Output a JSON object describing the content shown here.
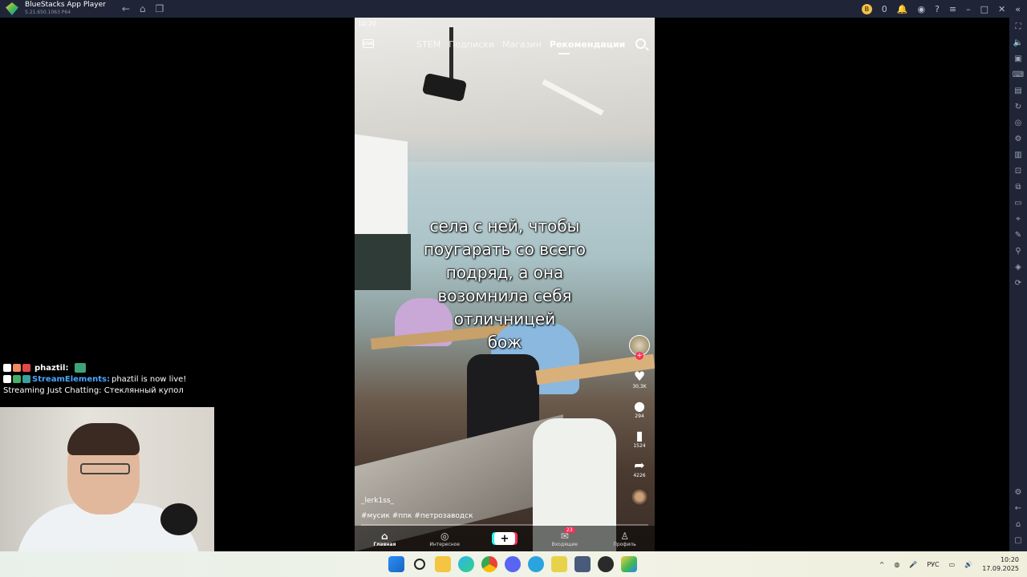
{
  "window": {
    "title": "BlueStacks App Player",
    "version": "5.21.650.1063 P64",
    "coins": "0"
  },
  "phone": {
    "status_time": "10:20",
    "live_label": "LIVE",
    "tabs": [
      {
        "label": "STEM"
      },
      {
        "label": "Подписки"
      },
      {
        "label": "Магазин"
      },
      {
        "label": "Рекомендации"
      }
    ],
    "caption_lines": [
      "села с ней, чтобы",
      "поугарать со всего",
      "подряд, а она",
      "возомнила себя",
      "отличницей",
      "бож"
    ],
    "actions": {
      "likes": "30,3K",
      "comments": "294",
      "saves": "1524",
      "shares": "4226"
    },
    "username": "_lerk1ss_",
    "hashtags": "#мусик #ппк #петрозаводск",
    "bottom_nav": [
      {
        "label": "Главная"
      },
      {
        "label": "Интересное"
      },
      {
        "label": "+"
      },
      {
        "label": "Входящие"
      },
      {
        "label": "Профиль"
      }
    ],
    "inbox_badge": "23"
  },
  "chat": {
    "messages": [
      {
        "user": "phaztil:",
        "text": ""
      },
      {
        "user": "StreamElements:",
        "text": " phaztil is now live!"
      },
      {
        "user": "",
        "text": "Streaming Just Chatting: Стеклянный купол"
      }
    ]
  },
  "taskbar": {
    "language": "РУС",
    "time": "10:20",
    "date": "17.09.2025"
  }
}
